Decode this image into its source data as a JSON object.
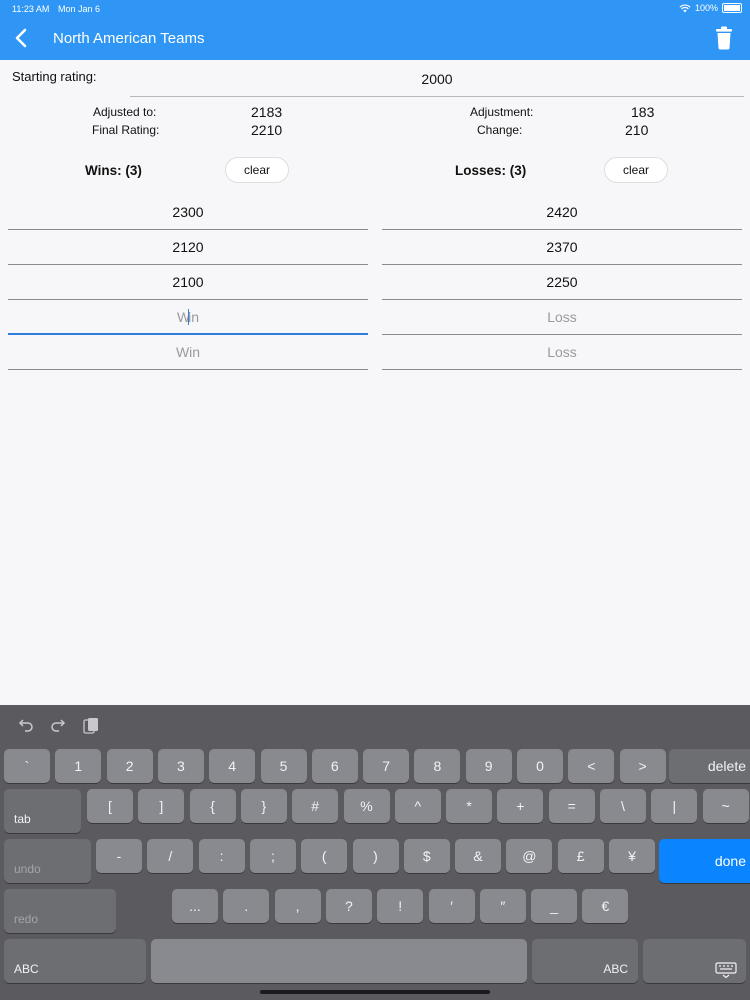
{
  "status": {
    "time": "11:23 AM",
    "date": "Mon Jan 6",
    "battery": "100%"
  },
  "nav": {
    "title": "North American Teams",
    "back_icon": "chevron-left-icon",
    "delete_icon": "trash-icon"
  },
  "rating": {
    "start_label": "Starting rating:",
    "start_value": "2000",
    "adjusted_label": "Adjusted to:",
    "adjusted_value": "2183",
    "final_label": "Final Rating:",
    "final_value": "2210",
    "adjustment_label": "Adjustment:",
    "adjustment_value": "183",
    "change_label": "Change:",
    "change_value": "210"
  },
  "wins": {
    "label": "Wins: (3)",
    "clear_label": "clear",
    "values": [
      "2300",
      "2120",
      "2100"
    ],
    "placeholders": [
      "Win",
      "Win"
    ]
  },
  "losses": {
    "label": "Losses: (3)",
    "clear_label": "clear",
    "values": [
      "2420",
      "2370",
      "2250"
    ],
    "placeholders": [
      "Loss",
      "Loss"
    ]
  },
  "keyboard": {
    "row1": [
      "`",
      "1",
      "2",
      "3",
      "4",
      "5",
      "6",
      "7",
      "8",
      "9",
      "0",
      "<",
      ">",
      "delete"
    ],
    "row2": [
      "tab",
      "[",
      "]",
      "{",
      "}",
      "#",
      "%",
      "^",
      "*",
      "+",
      "=",
      "\\",
      "|",
      "~"
    ],
    "row3": [
      "undo",
      "-",
      "/",
      ":",
      ";",
      "(",
      ")",
      "$",
      "&",
      "@",
      "£",
      "¥",
      "done"
    ],
    "row4": [
      "redo",
      "...",
      ".",
      ",",
      "?",
      "!",
      "′",
      "″",
      "_",
      "€"
    ],
    "row5": [
      "ABC",
      "",
      "ABC",
      "keyboard-dismiss-icon"
    ],
    "toolbar_icons": [
      "undo-icon",
      "redo-icon",
      "paste-icon"
    ]
  },
  "colors": {
    "accent": "#2f96f5",
    "done_key": "#0a84ff",
    "keyboard_bg": "#5b5b5f"
  }
}
